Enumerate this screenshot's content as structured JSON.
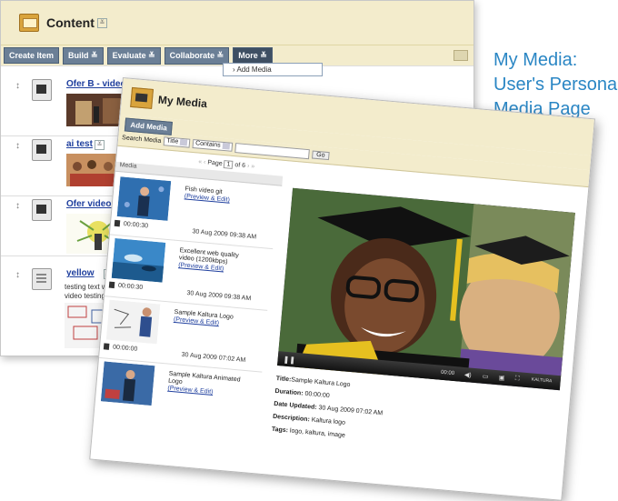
{
  "content_page": {
    "title": "Content",
    "toolbar": [
      "Create Item",
      "Build",
      "Evaluate",
      "Collaborate",
      "More"
    ],
    "more_menu": [
      "Add Media"
    ],
    "items": [
      {
        "name": "Ofer B - video test"
      },
      {
        "name": "ai test"
      },
      {
        "name": "Ofer video2"
      },
      {
        "name": "yellow",
        "text": "testing text with video\nvideo testing text with"
      }
    ]
  },
  "my_media": {
    "title": "My Media",
    "add_media": "Add Media",
    "search_label": "Search Media",
    "search_field": "Title",
    "search_op": "Contains",
    "go_label": "Go",
    "pager": {
      "label": "Page",
      "current": "1",
      "of": "of 6"
    },
    "list_header": "Media",
    "entries": [
      {
        "title": "Fish video git",
        "edit": "(Preview & Edit)",
        "duration": "00:00:30",
        "date": "30 Aug 2009 09:38 AM"
      },
      {
        "title": "Excellent web quality video (1200kbps)",
        "edit": "(Preview & Edit)",
        "duration": "00:00:30",
        "date": "30 Aug 2009 09:38 AM"
      },
      {
        "title": "Sample Kaltura Logo",
        "edit": "(Preview & Edit)",
        "duration": "00:00:00",
        "date": "30 Aug 2009 07:02 AM"
      },
      {
        "title": "Sample Kaltura Animated Logo",
        "edit": "(Preview & Edit)",
        "duration": "",
        "date": ""
      }
    ],
    "player": {
      "time_left": "00:00",
      "time_right": "00:00",
      "brand": "KALTURA"
    },
    "details": {
      "title_label": "Title:",
      "title_value": "Sample Kaltura Logo",
      "duration_label": "Duration:",
      "duration_value": "00:00:00",
      "updated_label": "Date Updated:",
      "updated_value": "30 Aug 2009 07:02 AM",
      "desc_label": "Description:",
      "desc_value": "Kaltura logo",
      "tags_label": "Tags:",
      "tags_value": "logo, kaltura, image"
    }
  },
  "caption": [
    "My Media:",
    "User's Persona",
    "Media Page"
  ],
  "colors": {
    "header_bg": "#f3eccc",
    "button_bg": "#6b7f96",
    "link": "#1f3f9e",
    "caption": "#2a86c4"
  }
}
